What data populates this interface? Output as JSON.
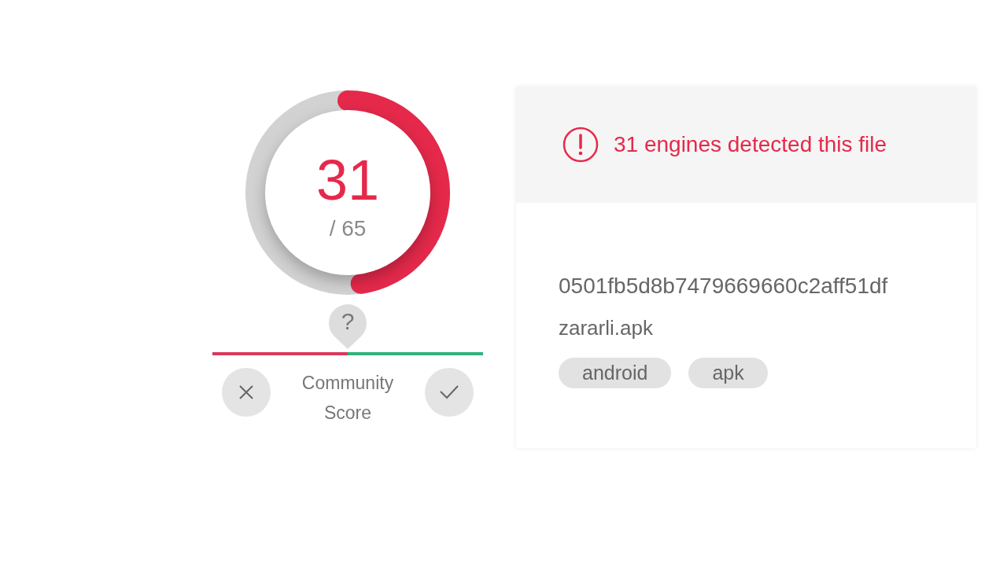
{
  "detection": {
    "count": "31",
    "total": "/ 65"
  },
  "community_score": {
    "label": "Community Score",
    "marker": "?",
    "level": 0.5
  },
  "card": {
    "message": "31 engines detected this file",
    "hash": "0501fb5d8b7479669660c2aff51df",
    "file_name": "zararli.apk",
    "tags": [
      "android",
      "apk"
    ]
  }
}
